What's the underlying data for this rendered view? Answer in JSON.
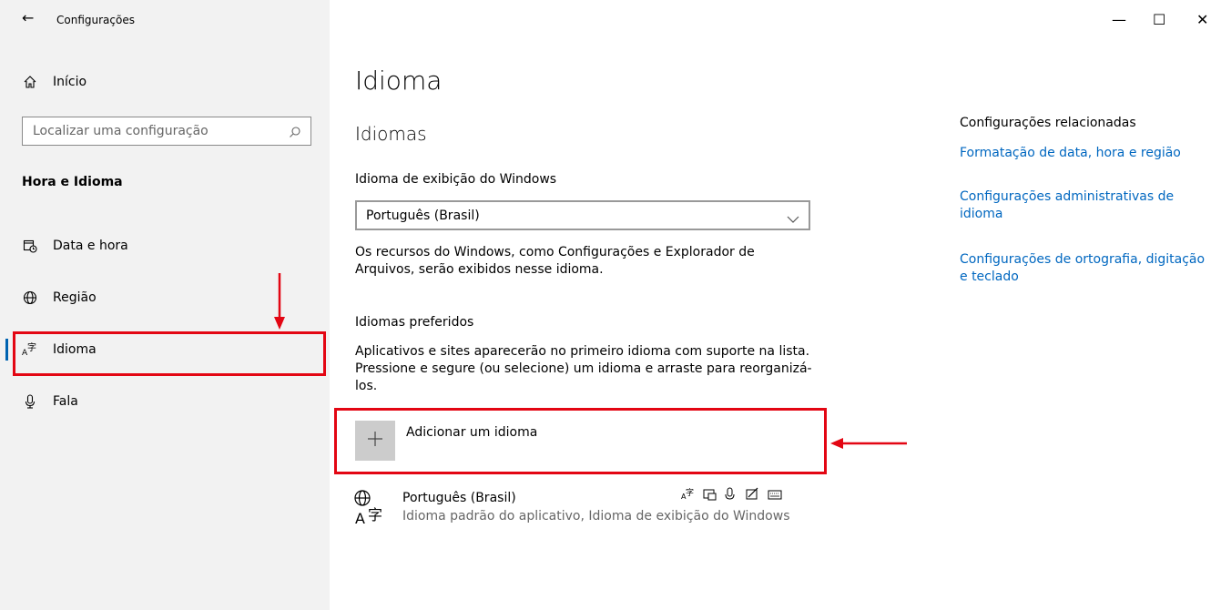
{
  "window": {
    "title": "Configurações",
    "controls": {
      "minimize": "—",
      "maximize": "☐",
      "close": "✕"
    }
  },
  "sidebar": {
    "home_label": "Início",
    "search_placeholder": "Localizar uma configuração",
    "section_title": "Hora e Idioma",
    "items": [
      {
        "label": "Data e hora",
        "icon": "calendar-clock-icon"
      },
      {
        "label": "Região",
        "icon": "globe-icon"
      },
      {
        "label": "Idioma",
        "icon": "language-icon",
        "active": true
      },
      {
        "label": "Fala",
        "icon": "microphone-icon"
      }
    ]
  },
  "main": {
    "page_title": "Idioma",
    "section_title": "Idiomas",
    "display_language_label": "Idioma de exibição do Windows",
    "display_language_value": "Português (Brasil)",
    "display_language_desc_1": "Os recursos do Windows, como Configurações e Explorador de",
    "display_language_desc_2": "Arquivos, serão exibidos nesse idioma.",
    "preferred_label": "Idiomas preferidos",
    "preferred_desc_1": "Aplicativos e sites aparecerão no primeiro idioma com suporte na lista.",
    "preferred_desc_2": "Pressione e segure (ou selecione) um idioma e arraste para reorganizá-",
    "preferred_desc_3": "los.",
    "add_language_label": "Adicionar um idioma",
    "languages": [
      {
        "name": "Português (Brasil)",
        "desc": "Idioma padrão do aplicativo, Idioma de exibição do Windows"
      }
    ]
  },
  "related": {
    "title": "Configurações relacionadas",
    "links": [
      [
        "Formatação de data, hora e região"
      ],
      [
        "Configurações administrativas de",
        "idioma"
      ],
      [
        "Configurações de ortografia, digitação",
        "e teclado"
      ]
    ]
  },
  "colors": {
    "accent": "#0067c0",
    "highlight": "#e30613",
    "sidebar_bg": "#f2f2f2"
  }
}
